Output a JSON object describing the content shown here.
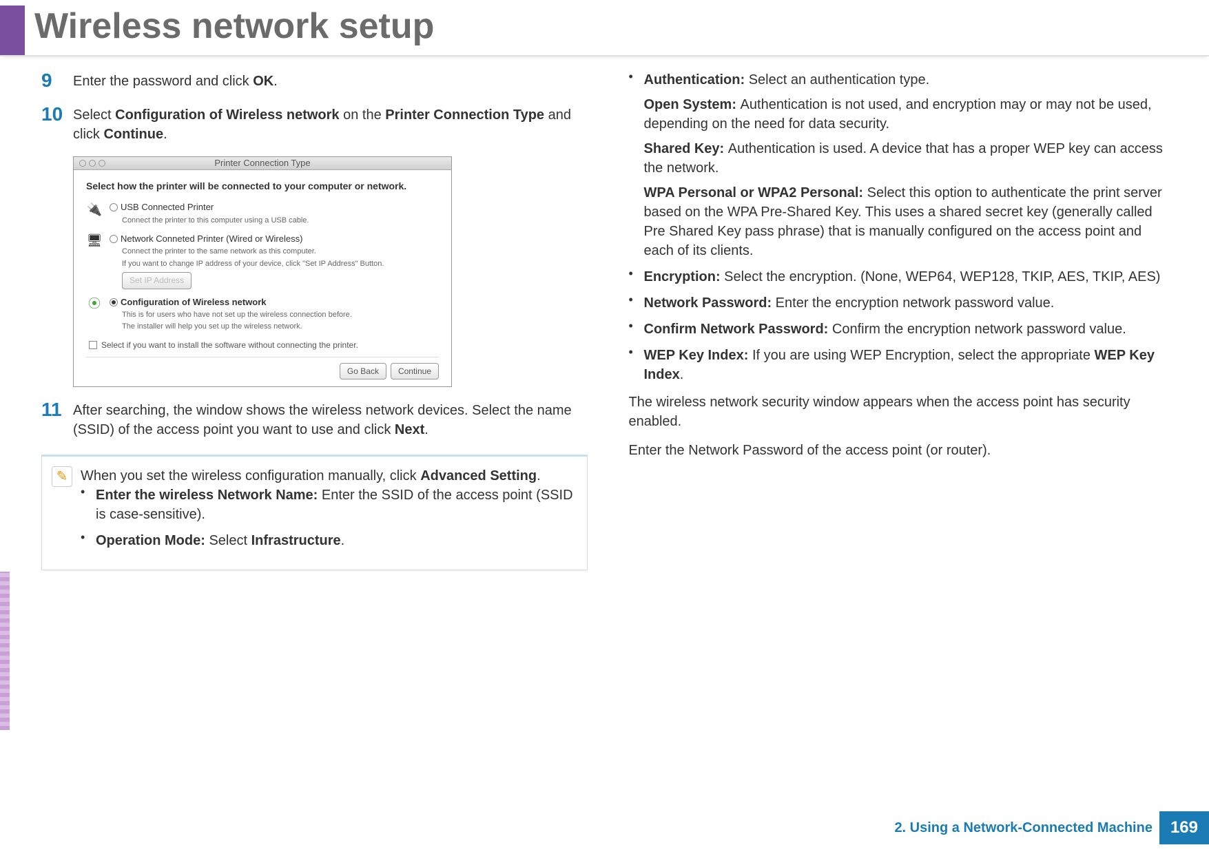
{
  "page_title": "Wireless network setup",
  "left_col": {
    "step9": {
      "num": "9",
      "text_a": "Enter the password and click ",
      "ok": "OK",
      "text_b": "."
    },
    "step10": {
      "num": "10",
      "a": "Select ",
      "b": "Configuration of Wireless network",
      "c": " on the ",
      "d": "Printer Connection Type",
      "e": " and click ",
      "f": "Continue",
      "g": "."
    },
    "screenshot": {
      "title": "Printer Connection Type",
      "heading": "Select how the printer will be connected to your computer or network.",
      "opt1": {
        "label": "USB Connected Printer",
        "desc": "Connect the printer to this computer using a USB cable."
      },
      "opt2": {
        "label": "Network Conneted Printer (Wired or Wireless)",
        "desc1": "Connect the printer to the same network as this computer.",
        "desc2": "If you want to change IP address of your device, click \"Set IP Address\" Button.",
        "btn": "Set IP Address"
      },
      "opt3": {
        "label": "Configuration of Wireless network",
        "desc1": "This is for users who have not set up the wireless connection before.",
        "desc2": "The installer will help you set up the wireless network."
      },
      "checkbox": "Select if you want to install the software without connecting the printer.",
      "go_back": "Go Back",
      "continue": "Continue"
    },
    "step11": {
      "num": "11",
      "a": "After searching, the window shows the wireless network devices. Select the name (SSID) of the access point you want to use and click ",
      "b": "Next",
      "c": "."
    },
    "note": {
      "intro_a": "When you set the wireless configuration manually, click ",
      "intro_b": "Advanced Setting",
      "intro_c": ".",
      "items": [
        {
          "bold": "Enter the wireless Network Name: ",
          "rest": "Enter the SSID of the access point (SSID is case-sensitive)."
        },
        {
          "bold": "Operation Mode: ",
          "rest_a": "Select ",
          "rest_b": "Infrastructure",
          "rest_c": "."
        }
      ]
    }
  },
  "right_col": {
    "auth": {
      "bold": "Authentication: ",
      "rest": "Select an authentication type."
    },
    "open_system": {
      "bold": "Open System: ",
      "rest": "Authentication is not used, and encryption may or may not be used, depending on the need for data security."
    },
    "shared_key": {
      "bold": "Shared Key: ",
      "rest": "Authentication is used. A device that has a proper WEP key can access the network."
    },
    "wpa": {
      "bold": "WPA Personal or WPA2 Personal: ",
      "rest": "Select this option to authenticate the print server based on the WPA Pre-Shared Key. This uses a shared secret key (generally called Pre Shared Key pass phrase) that is manually configured on the access point and each of its clients."
    },
    "encryption": {
      "bold": "Encryption: ",
      "rest": "Select the encryption. (None, WEP64, WEP128, TKIP, AES, TKIP, AES)"
    },
    "netpw": {
      "bold": "Network Password: ",
      "rest": "Enter the encryption network password value."
    },
    "confirm": {
      "bold": "Confirm Network Password: ",
      "rest": "Confirm the encryption network password value."
    },
    "wep": {
      "bold": "WEP Key Index: ",
      "rest_a": "If you are using WEP Encryption, select the appropriate ",
      "rest_b": "WEP Key Index",
      "rest_c": "."
    },
    "tail1": "The wireless network security window appears when the access point has security enabled.",
    "tail2": "Enter the Network Password of the access point (or router)."
  },
  "footer": {
    "chapter": "2.  Using a Network-Connected Machine",
    "page": "169"
  }
}
